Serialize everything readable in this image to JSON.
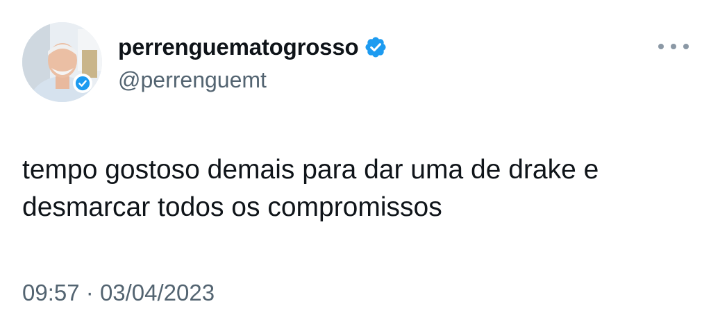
{
  "author": {
    "display_name": "perrenguematogrosso",
    "handle": "@perrenguemt",
    "verified": true,
    "avatar_icon": "avatar-photo",
    "verified_icon": "verified-badge-icon"
  },
  "menu": {
    "icon": "more-options-icon"
  },
  "tweet": {
    "text_lines": [
      "tempo gostoso demais para dar uma de drake e",
      "desmarcar todos os compromissos"
    ]
  },
  "meta": {
    "time": "09:57",
    "separator": "·",
    "date": "03/04/2023"
  },
  "colors": {
    "primary_text": "#0f1419",
    "secondary_text": "#536471",
    "verified_blue": "#1d9bf0",
    "more_dots": "#8b98a5"
  }
}
